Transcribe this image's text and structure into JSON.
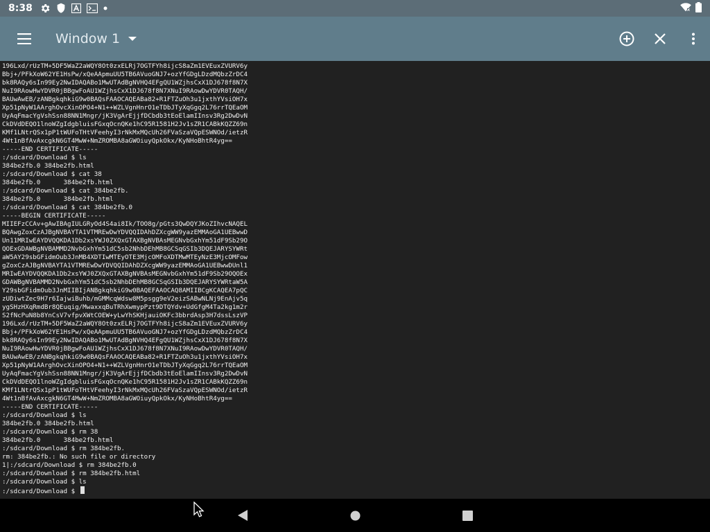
{
  "status_bar": {
    "time": "8:38",
    "icons": [
      "gear-icon",
      "shield-icon",
      "font-icon",
      "terminal-notification-icon",
      "dot-icon"
    ],
    "right_icons": [
      "wifi-icon",
      "battery-icon"
    ]
  },
  "app_bar": {
    "title": "Window 1",
    "icons": [
      "menu-icon",
      "dropdown-arrow-icon",
      "add-circle-icon",
      "close-icon",
      "overflow-menu-icon"
    ]
  },
  "terminal": {
    "lines": [
      "196Lxd/rUzTM+5DF5WaZ2aWQY8Ot0zxELRj7OGTFYh8ijcS8aZm1EVEuxZVURV6y",
      "Bbj+/PFkXoW62YE1HsPw/xQeAApmuUU5TB6AVuoGNJ7+ozYfGDgLDzdMQbzZrDC4",
      "bk8RAQy6sIn99Ey2NwIDAQABo1MwUTAdBgNVHQ4EFgQU1WZjhsCxX1DJ678f8N7X",
      "NuI9RAowHwYDVR0jBBgwFoAU1WZjhsCxX1DJ678f8N7XNuI9RAowDwYDVR0TAQH/",
      "BAUwAwEB/zANBgkqhkiG9w0BAQsFAAOCAQEABa82+R1FTZuOh3u1jxthYVsiOH7x",
      "Xp51pNyW1AArghOvcXinOPO4+N1++WZLVgnHnrO1eTDbJTyXqGgq2L76rrTQEaOM",
      "UyAqFmacYgVshSsn88NN1Mngr/jK3VgArEjjfDCbdb3tEoElamIInsv3Rg2DwDvN",
      "CkDVdDEQO1lnoWZgIdgbluisFGxqOcnQKe1hC95R1581H2Jv1sZR1CABkKQZZ69n",
      "KMf1LNtrQSx1pP1tWUFoTHtVFeehyI3rNkMxMQcUh26FVaSzaVQpESWNOd/ietzR",
      "4Wt1nBfAvAxcgkN6GT4MwW+NmZROMBA8aGWOiuyQpkOkx/KyNHoBhtR4yg==",
      "-----END CERTIFICATE-----",
      ":/sdcard/Download $ ls",
      "384be2fb.0 384be2fb.html",
      ":/sdcard/Download $ cat 38",
      "384be2fb.0      384be2fb.html",
      ":/sdcard/Download $ cat 384be2fb.",
      "384be2fb.0      384be2fb.html",
      ":/sdcard/Download $ cat 384be2fb.0",
      "-----BEGIN CERTIFICATE-----",
      "MIIEFzCCAv+gAwIBAgIULGRyOd4S4ai8Ik/TOO8g/pGts3QwDQYJKoZIhvcNAQEL",
      "BQAwgZoxCzAJBgNVBAYTA1VTMREwDwYDVQQIDAhDZXcgWW9yazEMMAoGA1UEBwwD",
      "Un11MRIwEAYDVQQKDA1Db2xsYWJ0ZXQxGTAXBgNVBAsMEGNvbGxhYm51dF9Sb29O",
      "QOExGDAWBgNVBAMMD2NvbGxhYm51dC5sb2NhbDEhMB8GCSqGSIb3DQEJARYSYWRt",
      "aW5AY29sbGFidmOub3JnMB4XDTIwMTEyOTE3MjcOMFoXDTMwMTEyNzE3MjcOMFow",
      "gZoxCzAJBgNVBAYTA1VTMREwDwYDVQQIDAhDZXcgWW9yazEMMAoGA1UEBwwDUnl1",
      "MRIwEAYDVQQKDA1Db2xsYWJ0ZXQxGTAXBgNVBAsMEGNvbGxhYm51dF9Sb29OQOEx",
      "GDAWBgNVBAMMD2NvbGxhYm51dC5sb2NhbDEhMB8GCSqGSIb3DQEJARYSYWRtaW5A",
      "Y29sbGFidmOub3JnMIIBIjANBgkqhkiG9w0BAQEFAAOCAQ8AMIIBCgKCAQEA7pQC",
      "zUDiwtZec9H7r6IajwiBuhb/mGMMcqWdsw8M5psgg9eV2eizSABwNLNj9EnAjv5q",
      "ygSHzHXqRmdBr8QEuqig/MwaxxqBuTRhXwmypPzt9DTQYdv+UdGfgM4Ta2kg1m2r",
      "S2fNcPuN8b8YnCsV7vfpvXWtCOEW+yLwYhSKHjauiOKFc3bbrdAsp3H7dssLszVP",
      "196Lxd/rUzTM+5DF5WaZ2aWQY8Ot0zxELRj7OGTFYh8ijcS8aZm1EVEuxZVURV6y",
      "Bbj+/PFkXoW62YE1HsPw/xQeAApmuUU5TB6AVuoGNJ7+ozYfGDgLDzdMQbzZrDC4",
      "bk8RAQy6sIn99Ey2NwIDAQABo1MwUTAdBgNVHQ4EFgQU1WZjhsCxX1DJ678f8N7X",
      "NuI9RAowHwYDVR0jBBgwFoAU1WZjhsCxX1DJ678f8N7XNuI9RAowDwYDVR0TAQH/",
      "BAUwAwEB/zANBgkqhkiG9w0BAQsFAAOCAQEABa82+R1FTZuOh3u1jxthYVsiOH7x",
      "Xp51pNyW1AArghOvcXinOPO4+N1++WZLVgnHnrO1eTDbJTyXqGgq2L76rrTQEaOM",
      "UyAqFmacYgVshSsn88NN1Mngr/jK3VgArEjjfDCbdb3tEoElamIInsv3Rg2DwDvN",
      "CkDVdDEQO1lnoWZgIdgbluisFGxqOcnQKe1hC95R1581H2Jv1sZR1CABkKQZZ69n",
      "KMf1LNtrQSx1pP1tWUFoTHtVFeehyI3rNkMxMQcUh26FVaSzaVQpESWNOd/ietzR",
      "4Wt1nBfAvAxcgkN6GT4MwW+NmZROMBA8aGWOiuyQpkOkx/KyNHoBhtR4yg==",
      "-----END CERTIFICATE-----",
      ":/sdcard/Download $ ls",
      "384be2fb.0 384be2fb.html",
      ":/sdcard/Download $ rm 38",
      "384be2fb.0      384be2fb.html",
      ":/sdcard/Download $ rm 384be2fb.",
      "rm: 384be2fb.: No such file or directory",
      "1|:/sdcard/Download $ rm 384be2fb.0",
      ":/sdcard/Download $ rm 384be2fb.html",
      ":/sdcard/Download $ ls",
      ":/sdcard/Download $ "
    ]
  },
  "nav_bar": {
    "icons": [
      "back-icon",
      "home-icon",
      "recents-icon"
    ]
  },
  "mouse_pointer": "cursor-arrow-icon"
}
